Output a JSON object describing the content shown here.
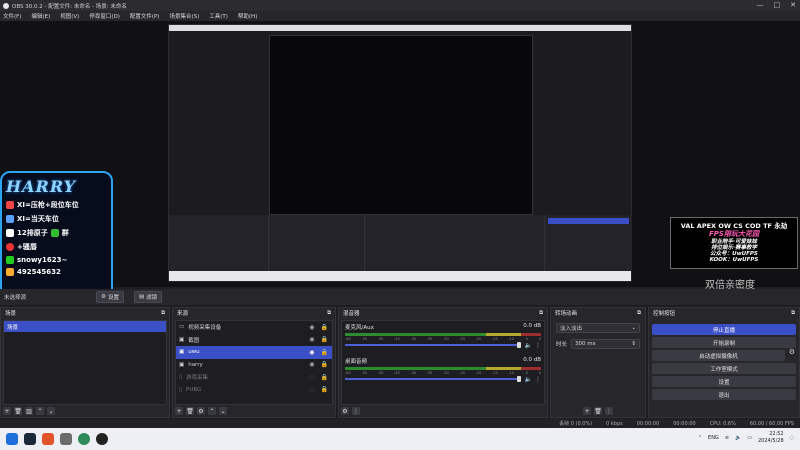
{
  "window": {
    "title": "OBS 30.0.2 - 配置文件: 未命名 - 场景: 未命名",
    "controls": [
      "—",
      "□",
      "✕"
    ]
  },
  "menu": [
    "文件(F)",
    "编辑(E)",
    "视图(V)",
    "停靠窗口(D)",
    "配置文件(P)",
    "场景集合(S)",
    "工具(T)",
    "帮助(H)"
  ],
  "overlay_left": {
    "name": "HARRY",
    "lines": [
      "XI=压枪+段位车位",
      "XI=当天车位",
      "12排原子",
      "+骚唇",
      "snowy1623~",
      "492545632"
    ],
    "line_suffix": "群"
  },
  "overlay_right": {
    "title": "VAL APEX OW CS COD TF 永劫",
    "lines": [
      "FPS陪玩大花园",
      "职业陪手·可爱妹妹",
      "排位娱乐·赛事教学",
      "公众号：UwUFPS",
      "KOOK：UwUFPS"
    ],
    "footer": "双倍亲密度"
  },
  "controlbar": {
    "no_source": "未选择源",
    "properties": "设置",
    "filters": "滤镜"
  },
  "scenes": {
    "title": "场景",
    "items": [
      "场景"
    ]
  },
  "sources": {
    "title": "来源",
    "items": [
      {
        "label": "视频采集设备",
        "state": "normal"
      },
      {
        "label": "截图",
        "state": "normal"
      },
      {
        "label": "uwu",
        "state": "selected"
      },
      {
        "label": "harry",
        "state": "normal"
      },
      {
        "label": "游戏采集",
        "state": "dim"
      },
      {
        "label": "PUBG",
        "state": "dim"
      }
    ]
  },
  "mixer": {
    "title": "混音器",
    "tracks": [
      {
        "name": "麦克风/Aux",
        "db": "0.0 dB"
      },
      {
        "name": "桌面音频",
        "db": "0.0 dB"
      }
    ],
    "ticks": [
      "-60",
      "-55",
      "-50",
      "-45",
      "-40",
      "-35",
      "-30",
      "-25",
      "-20",
      "-15",
      "-10",
      "-5",
      "0"
    ]
  },
  "transitions": {
    "title": "转场动画",
    "type": "淡入淡出",
    "duration_label": "时长",
    "duration": "300 ms"
  },
  "controls": {
    "title": "控制按钮",
    "buttons": [
      "停止直播",
      "开始录制",
      "启动虚拟摄像机",
      "工作室模式",
      "设置",
      "退出"
    ]
  },
  "status": {
    "dropped": "丢帧 0 (0.0%)",
    "bitrate": "0 kbps",
    "live": "00:00:00",
    "rec": "00:00:00",
    "cpu": "CPU: 0.6%",
    "fps": "60.00 / 60.00 FPS"
  },
  "taskbar": {
    "lang": "ENG",
    "time": "22:52",
    "date": "2024/5/28"
  },
  "colors": {
    "accent": "#3b4fc6",
    "panel": "#26262b",
    "bg": "#1e1e22"
  }
}
